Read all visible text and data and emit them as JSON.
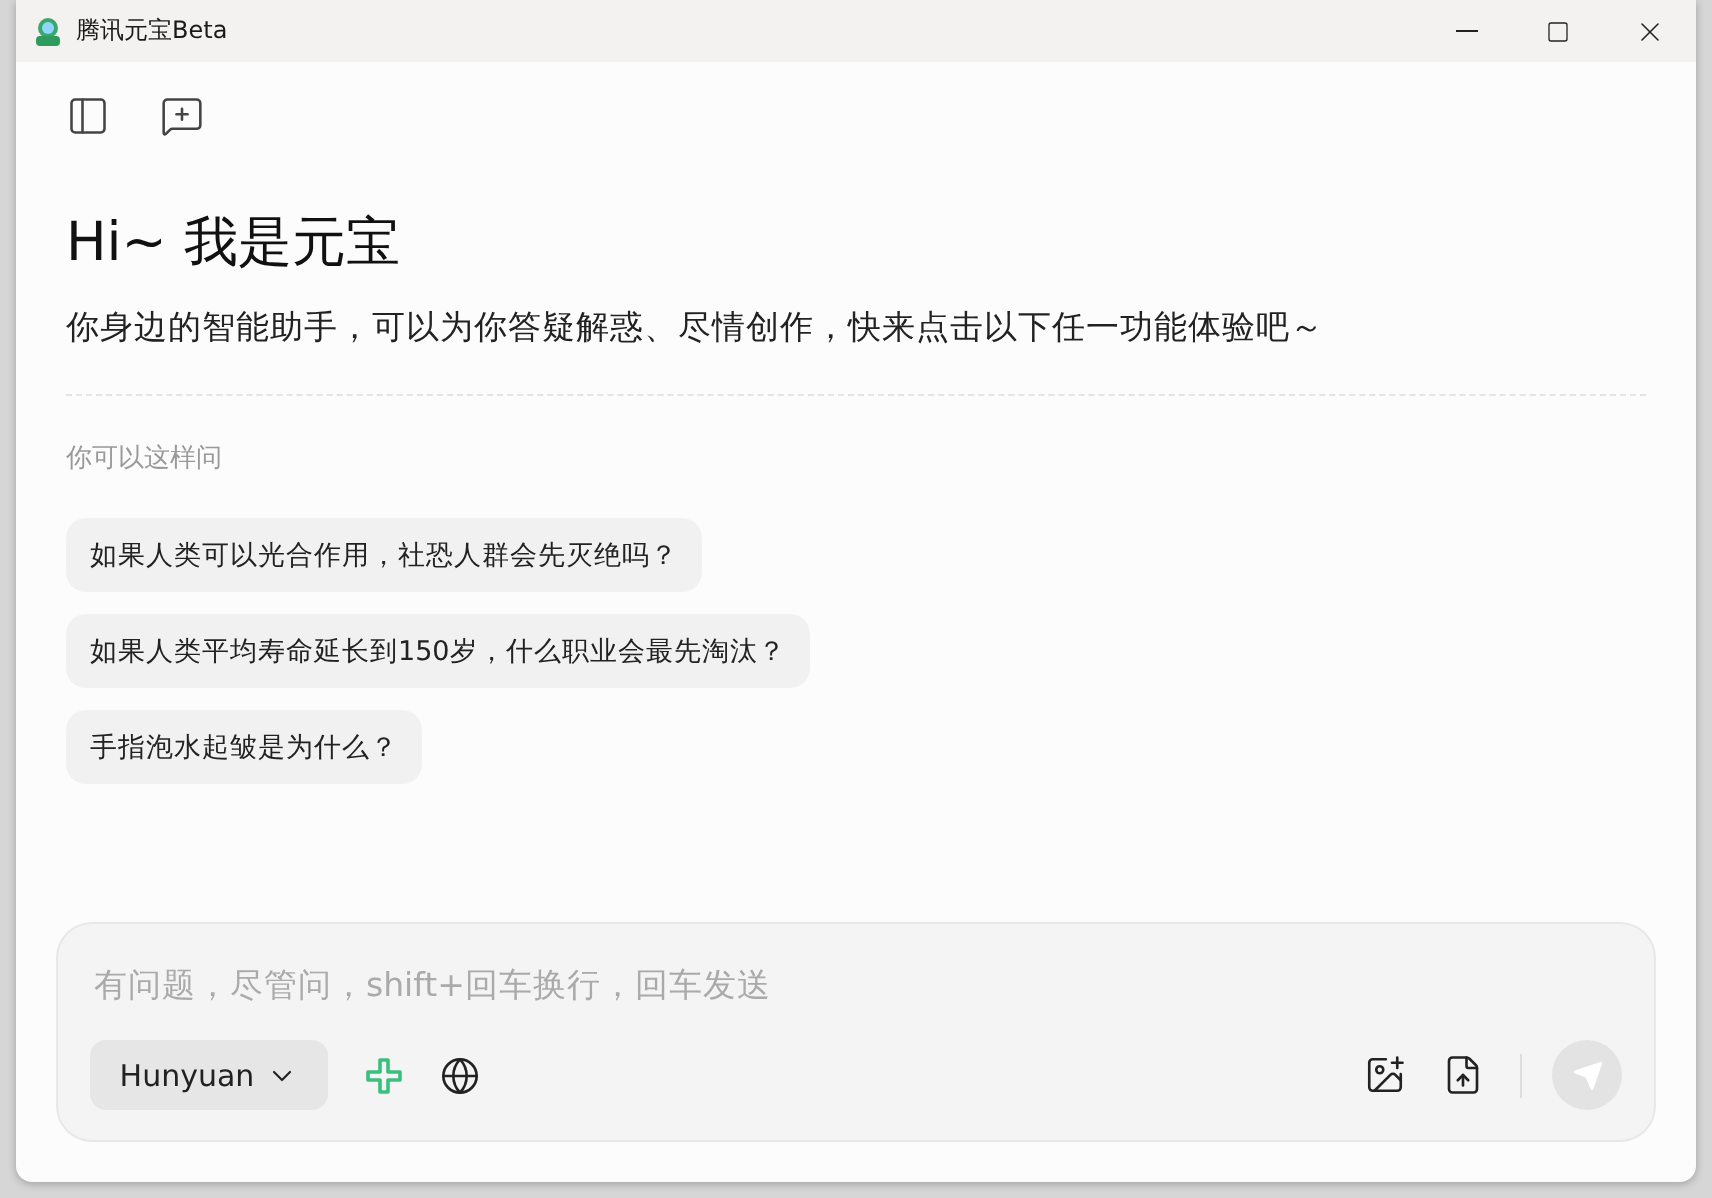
{
  "window": {
    "title": "腾讯元宝Beta"
  },
  "heading": "Hi~ 我是元宝",
  "subtitle": "你身边的智能助手，可以为你答疑解惑、尽情创作，快来点击以下任一功能体验吧～",
  "suggestions_label": "你可以这样问",
  "suggestions": [
    "如果人类可以光合作用，社恐人群会先灭绝吗？",
    "如果人类平均寿命延长到150岁，什么职业会最先淘汰？",
    "手指泡水起皱是为什么？"
  ],
  "composer": {
    "placeholder": "有问题，尽管问，shift+回车换行，回车发送",
    "model": "Hunyuan",
    "send_disabled": true
  }
}
